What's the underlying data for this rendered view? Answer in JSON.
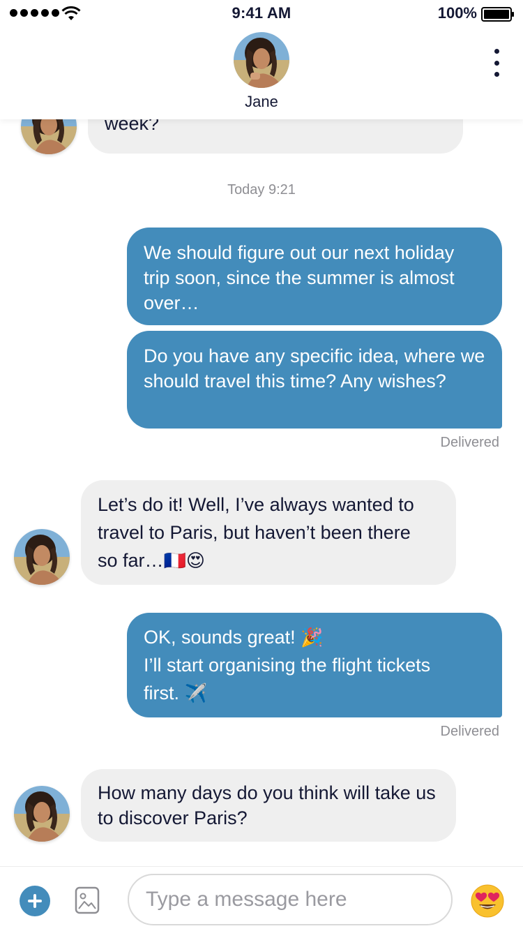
{
  "status_bar": {
    "time": "9:41 AM",
    "battery": "100%"
  },
  "header": {
    "contact_name": "Jane"
  },
  "messages": [
    {
      "direction": "in",
      "text": "week?"
    },
    {
      "type": "timestamp",
      "text": "Today 9:21"
    },
    {
      "direction": "out",
      "text": "We should figure out our next holiday trip soon, since the summer is almost over…"
    },
    {
      "direction": "out",
      "text": "Do you have any specific idea, where we should travel this time? Any wishes?",
      "status": "Delivered"
    },
    {
      "direction": "in",
      "lines": [
        "Let’s do it! Well, I’ve always wanted to",
        "travel to Paris, but haven’t been there",
        "so far…"
      ],
      "emojis": [
        "🇫🇷",
        "😍"
      ]
    },
    {
      "direction": "out",
      "lines": [
        "OK, sounds great!",
        "I’ll start organising the flight tickets",
        "first."
      ],
      "emojis": [
        "🎉",
        "✈️"
      ],
      "status": "Delivered"
    },
    {
      "direction": "in",
      "text": "How many days do you think will take us to discover Paris?"
    }
  ],
  "composer": {
    "placeholder": "Type a message here"
  },
  "icons": {
    "add": "plus-circle-icon",
    "image": "image-icon",
    "emoji": "heart-eyes-emoji-icon",
    "more": "more-vertical-icon"
  },
  "colors": {
    "accent": "#438cbb",
    "incoming_bubble": "#efefef",
    "text": "#141834",
    "meta": "#8e8e93"
  }
}
